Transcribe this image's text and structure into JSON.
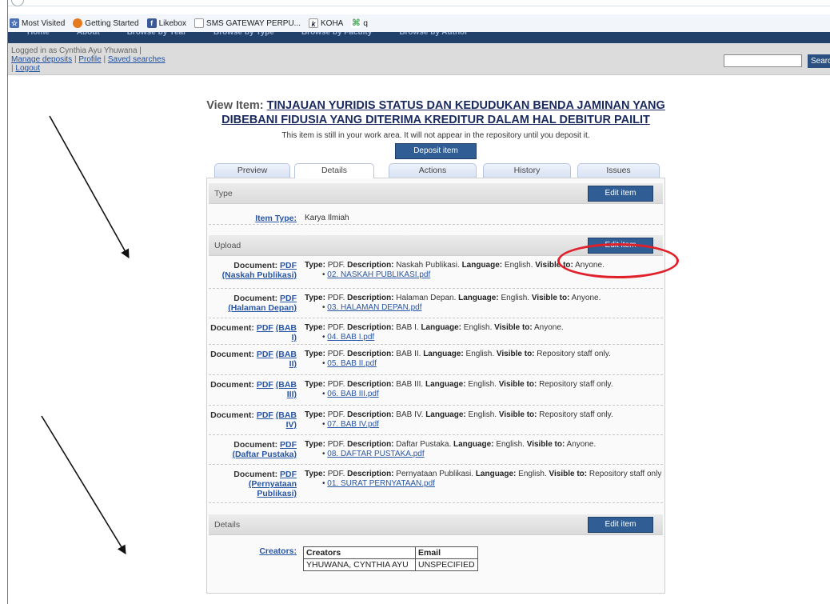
{
  "bookmarks": [
    {
      "label": "Most Visited",
      "icon": "bookmark-icon"
    },
    {
      "label": "Getting Started",
      "icon": "firefox-icon"
    },
    {
      "label": "Likebox",
      "icon": "facebook-icon"
    },
    {
      "label": "SMS GATEWAY PERPU...",
      "icon": "page-icon"
    },
    {
      "label": "KOHA",
      "icon": "koha-icon"
    },
    {
      "label": "q",
      "icon": "q-icon"
    }
  ],
  "site_nav": [
    "Home",
    "About",
    "Browse by Year",
    "Browse by Type",
    "Browse by Faculty",
    "Browse by Author"
  ],
  "login": {
    "logged_in_text": "Logged in as Cynthia Ayu Yhuwana |",
    "manage_deposits": "Manage deposits",
    "profile": "Profile",
    "saved_searches": "Saved searches",
    "logout": "Logout",
    "sep": "|"
  },
  "search": {
    "value": "",
    "button": "Search"
  },
  "view": {
    "title_label": "View Item:",
    "title_line1": "TINJAUAN YURIDIS STATUS DAN KEDUDUKAN BENDA JAMINAN YANG",
    "title_line2": "DIBEBANI FIDUSIA YANG DITERIMA KREDITUR DALAM HAL DEBITUR PAILIT",
    "notice": "This item is still in your work area. It will not appear in the repository until you deposit it.",
    "deposit_button": "Deposit item"
  },
  "tabs": [
    {
      "label": "Preview",
      "active": false
    },
    {
      "label": "Details",
      "active": true
    },
    {
      "label": "Actions",
      "active": false
    },
    {
      "label": "History",
      "active": false
    },
    {
      "label": "Issues",
      "active": false
    }
  ],
  "edit_button": "Edit item",
  "sections": {
    "type": {
      "name": "Type",
      "item_type_label": "Item Type:",
      "item_type_value": "Karya Ilmiah"
    },
    "upload": {
      "name": "Upload"
    },
    "details": {
      "name": "Details",
      "creators_label": "Creators:"
    }
  },
  "documents": [
    {
      "doc": "Document:",
      "pdf": "PDF",
      "name": "(Naskah Publikasi)",
      "type_k": "Type:",
      "type_v": "PDF.",
      "desc_k": "Description:",
      "desc_v": "Naskah Publikasi.",
      "lang_k": "Language:",
      "lang_v": "English.",
      "vis_k": "Visible to:",
      "vis_v": "Anyone.",
      "file": "02. NASKAH PUBLIKASI.pdf"
    },
    {
      "doc": "Document:",
      "pdf": "PDF",
      "name": "(Halaman Depan)",
      "type_k": "Type:",
      "type_v": "PDF.",
      "desc_k": "Description:",
      "desc_v": "Halaman Depan.",
      "lang_k": "Language:",
      "lang_v": "English.",
      "vis_k": "Visible to:",
      "vis_v": "Anyone.",
      "file": "03. HALAMAN DEPAN.pdf"
    },
    {
      "doc": "Document:",
      "pdf": "PDF",
      "name": "(BAB I)",
      "type_k": "Type:",
      "type_v": "PDF.",
      "desc_k": "Description:",
      "desc_v": "BAB I.",
      "lang_k": "Language:",
      "lang_v": "English.",
      "vis_k": "Visible to:",
      "vis_v": "Anyone.",
      "file": "04. BAB I.pdf"
    },
    {
      "doc": "Document:",
      "pdf": "PDF",
      "name": "(BAB II)",
      "type_k": "Type:",
      "type_v": "PDF.",
      "desc_k": "Description:",
      "desc_v": "BAB II.",
      "lang_k": "Language:",
      "lang_v": "English.",
      "vis_k": "Visible to:",
      "vis_v": "Repository staff only.",
      "file": "05. BAB II.pdf"
    },
    {
      "doc": "Document:",
      "pdf": "PDF",
      "name": "(BAB III)",
      "type_k": "Type:",
      "type_v": "PDF.",
      "desc_k": "Description:",
      "desc_v": "BAB III.",
      "lang_k": "Language:",
      "lang_v": "English.",
      "vis_k": "Visible to:",
      "vis_v": "Repository staff only.",
      "file": "06. BAB III.pdf"
    },
    {
      "doc": "Document:",
      "pdf": "PDF",
      "name": "(BAB IV)",
      "type_k": "Type:",
      "type_v": "PDF.",
      "desc_k": "Description:",
      "desc_v": "BAB IV.",
      "lang_k": "Language:",
      "lang_v": "English.",
      "vis_k": "Visible to:",
      "vis_v": "Repository staff only.",
      "file": "07. BAB IV.pdf"
    },
    {
      "doc": "Document:",
      "pdf": "PDF",
      "name": "(Daftar Pustaka)",
      "type_k": "Type:",
      "type_v": "PDF.",
      "desc_k": "Description:",
      "desc_v": "Daftar Pustaka.",
      "lang_k": "Language:",
      "lang_v": "English.",
      "vis_k": "Visible to:",
      "vis_v": "Anyone.",
      "file": "08. DAFTAR PUSTAKA.pdf"
    },
    {
      "doc": "Document:",
      "pdf": "PDF",
      "name": "(Pernyataan Publikasi)",
      "type_k": "Type:",
      "type_v": "PDF.",
      "desc_k": "Description:",
      "desc_v": "Pernyataan Publikasi.",
      "lang_k": "Language:",
      "lang_v": "English.",
      "vis_k": "Visible to:",
      "vis_v": "Repository staff only",
      "file": "01. SURAT PERNYATAAN.pdf"
    }
  ],
  "creators_table": {
    "headers": [
      "Creators",
      "Email"
    ],
    "rows": [
      [
        "YHUWANA, CYNTHIA AYU",
        "UNSPECIFIED"
      ]
    ]
  },
  "colors": {
    "nav": "#21416b",
    "button": "#2f5d94",
    "highlight": "#e0202a",
    "link": "#2a56a6"
  }
}
